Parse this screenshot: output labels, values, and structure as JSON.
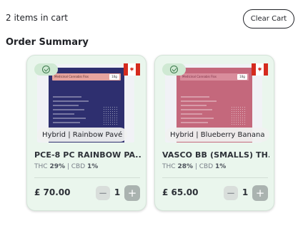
{
  "cart": {
    "count_text": "2 items in cart",
    "clear_label": "Clear Cart",
    "summary_title": "Order Summary"
  },
  "products": [
    {
      "strain": "Hybrid | Rainbow Pavé",
      "name": "PCE-8 PC RAINBOW PA...",
      "thc_label": "THC",
      "thc": "29%",
      "cbd_label": "CBD",
      "cbd": "1%",
      "price": "£ 70.00",
      "quantity": "1",
      "pack_label": "Medicinal Cannabis Flos",
      "pack_weight": "10g",
      "pack_color": "#2e2f6f",
      "flag": "canada-flag-icon"
    },
    {
      "strain": "Hybrid | Blueberry Banana",
      "name": "VASCO BB (SMALLS) TH...",
      "thc_label": "THC",
      "thc": "28%",
      "cbd_label": "CBD",
      "cbd": "1%",
      "price": "£ 65.00",
      "quantity": "1",
      "pack_label": "Medicinal Cannabis Flos",
      "pack_weight": "10g",
      "pack_color": "#c4687c",
      "flag": "canada-flag-icon"
    }
  ],
  "controls": {
    "minus": "−",
    "plus": "+"
  }
}
